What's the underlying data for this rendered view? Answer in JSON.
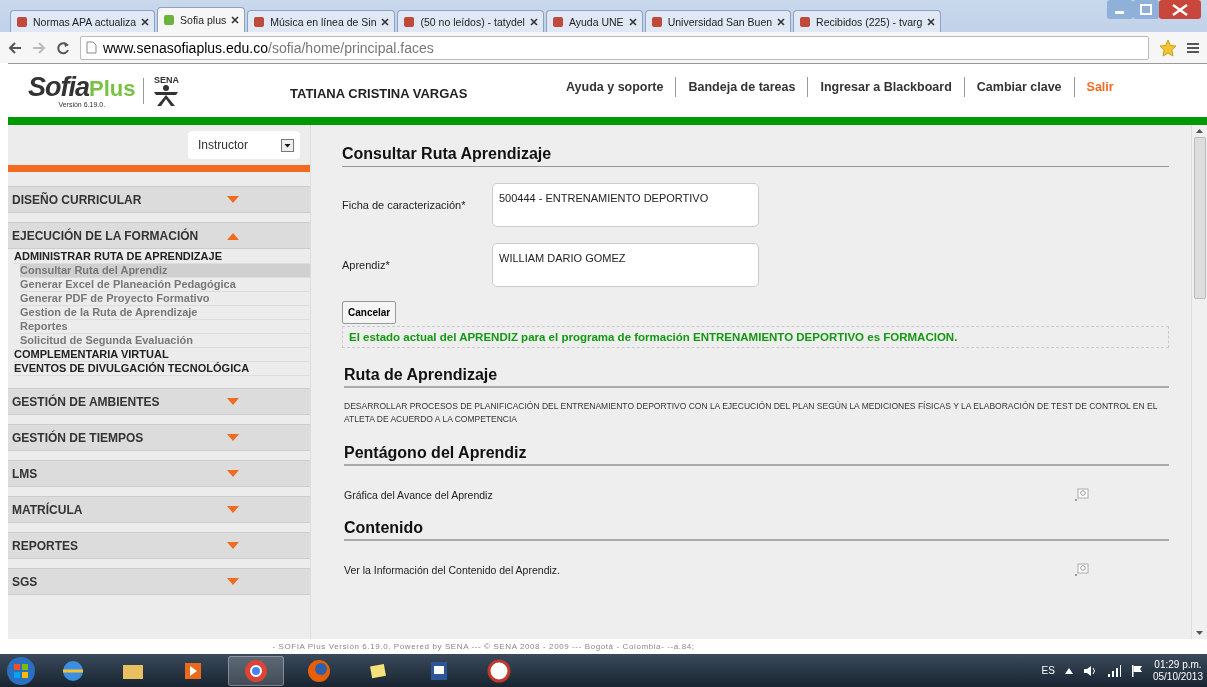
{
  "browser": {
    "tabs": [
      {
        "title": "Normas APA actualiza",
        "selected": false
      },
      {
        "title": "Sofia plus",
        "selected": true
      },
      {
        "title": "Música en línea de Sin",
        "selected": false
      },
      {
        "title": "(50 no leídos) - tatydel",
        "selected": false
      },
      {
        "title": "Ayuda UNE",
        "selected": false
      },
      {
        "title": "Universidad San Buen",
        "selected": false
      },
      {
        "title": "Recibidos (225) - tvarg",
        "selected": false
      }
    ],
    "address": {
      "host": "www.senasofiaplus.edu.co",
      "path": "/sofia/home/principal.faces"
    }
  },
  "header": {
    "logo": {
      "name": "Sofia",
      "suffix": "Plus",
      "version": "Versión 6.19.0.",
      "org": "SENA"
    },
    "user": "TATIANA CRISTINA VARGAS",
    "links": [
      {
        "label": "Ayuda y soporte",
        "kind": "normal"
      },
      {
        "label": "Bandeja de tareas",
        "kind": "normal"
      },
      {
        "label": "Ingresar a Blackboard",
        "kind": "normal"
      },
      {
        "label": "Cambiar clave",
        "kind": "normal"
      },
      {
        "label": "Salir",
        "kind": "exit"
      }
    ]
  },
  "sidebar": {
    "role": "Instructor",
    "menu": [
      {
        "label": "DISEÑO CURRICULAR",
        "expanded": false
      },
      {
        "label": "EJECUCIÓN DE LA FORMACIÓN",
        "expanded": true,
        "children": [
          {
            "label": "ADMINISTRAR RUTA DE APRENDIZAJE",
            "children": [
              {
                "label": "Consultar Ruta del Aprendiz",
                "selected": true
              },
              {
                "label": "Generar Excel de Planeación Pedagógica",
                "selected": false
              },
              {
                "label": "Generar PDF de Proyecto Formativo",
                "selected": false
              },
              {
                "label": "Gestion de la Ruta de Aprendizaje",
                "selected": false
              },
              {
                "label": "Reportes",
                "selected": false
              },
              {
                "label": "Solicitud de Segunda Evaluación",
                "selected": false
              }
            ]
          },
          {
            "label": "COMPLEMENTARIA VIRTUAL"
          },
          {
            "label": "EVENTOS DE DIVULGACIÓN TECNOLÓGICA"
          }
        ]
      },
      {
        "label": "GESTIÓN DE AMBIENTES",
        "expanded": false
      },
      {
        "label": "GESTIÓN DE TIEMPOS",
        "expanded": false
      },
      {
        "label": "LMS",
        "expanded": false
      },
      {
        "label": "MATRÍCULA",
        "expanded": false
      },
      {
        "label": "REPORTES",
        "expanded": false
      },
      {
        "label": "SGS",
        "expanded": false
      }
    ]
  },
  "main": {
    "title": "Consultar Ruta Aprendizaje",
    "fields": [
      {
        "label": "Ficha de caracterización*",
        "value": "500444 - ENTRENAMIENTO DEPORTIVO"
      },
      {
        "label": "Aprendiz*",
        "value": "WILLIAM DARIO GOMEZ"
      }
    ],
    "button": "Cancelar",
    "status_message": "El estado actual del APRENDIZ para el programa de formación ENTRENAMIENTO DEPORTIVO es FORMACION.",
    "sections": [
      {
        "title": "Ruta de Aprendizaje",
        "kind": "text",
        "text": "DESARROLLAR PROCESOS DE PLANIFICACIÓN DEL ENTRENAMIENTO DEPORTIVO CON LA EJECUCIÓN DEL PLAN SEGÚN LA MEDICIONES FÍSICAS Y LA ELABORACIÓN DE TEST DE CONTROL EN EL ATLETA DE ACUERDO A LA COMPETENCIA"
      },
      {
        "title": "Pentágono del Aprendiz",
        "kind": "action",
        "text": "Gráfica del Avance del Aprendiz"
      },
      {
        "title": "Contenido",
        "kind": "action",
        "text": "Ver la Información del Contenido del Aprendiz."
      }
    ]
  },
  "footer": "- SOFIA Plus Versión 6.19.0. Powered by SENA --- © SENA 2008 - 2009 --- Bogotá - Colombia- --a.84;",
  "taskbar": {
    "language": "ES",
    "time": "01:29 p.m.",
    "date": "05/10/2013"
  }
}
